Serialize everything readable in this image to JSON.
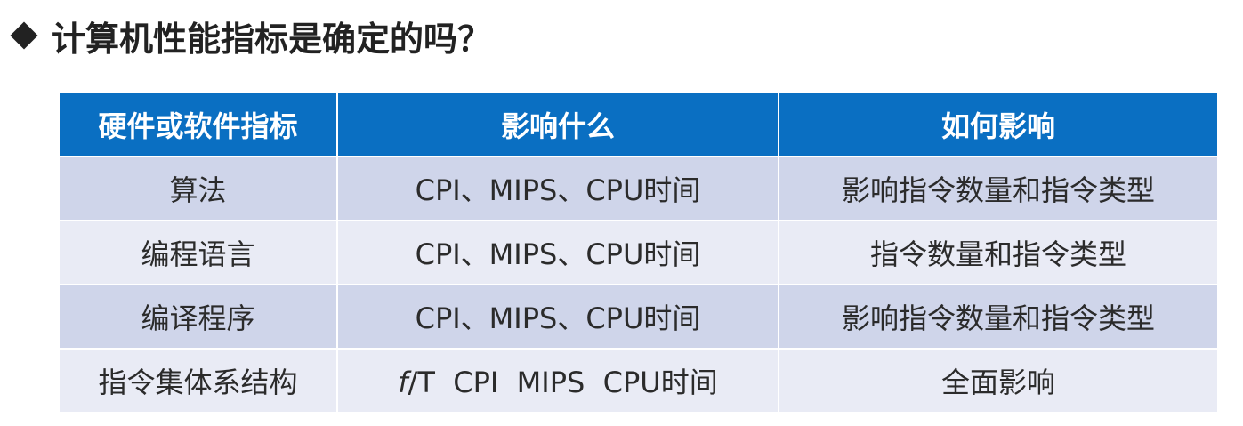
{
  "heading": {
    "bullet_icon": "diamond-bullet-icon",
    "text": "计算机性能指标是确定的吗？"
  },
  "table": {
    "header_color": "#0a6fc2",
    "row_colors": [
      "#cfd5ea",
      "#e9ebf5"
    ],
    "headers": [
      "硬件或软件指标",
      "影响什么",
      "如何影响"
    ],
    "rows": [
      {
        "factor": "算法",
        "affects": "CPI、MIPS、CPU时间",
        "how": "影响指令数量和指令类型"
      },
      {
        "factor": "编程语言",
        "affects": "CPI、MIPS、CPU时间",
        "how": "指令数量和指令类型"
      },
      {
        "factor": "编译程序",
        "affects": "CPI、MIPS、CPU时间",
        "how": "影响指令数量和指令类型"
      },
      {
        "factor": "指令集体系结构",
        "affects_prefix": "f",
        "affects": "/T  CPI  MIPS  CPU时间",
        "how": "全面影响"
      }
    ]
  }
}
